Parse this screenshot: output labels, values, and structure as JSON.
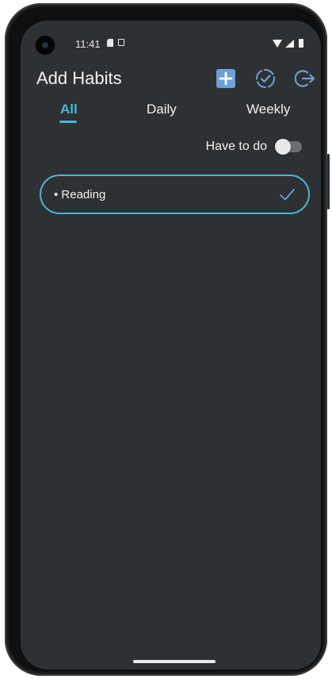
{
  "status_bar": {
    "time": "11:41"
  },
  "app": {
    "title": "Add Habits"
  },
  "header_actions": {
    "add_icon": "add-square-icon",
    "check_icon": "dashed-circle-check-icon",
    "logout_icon": "logout-icon"
  },
  "tabs": [
    {
      "label": "All",
      "selected": true
    },
    {
      "label": "Daily",
      "selected": false
    },
    {
      "label": "Weekly",
      "selected": false
    }
  ],
  "filter": {
    "label": "Have to do",
    "enabled": false
  },
  "habits": [
    {
      "text": "• Reading",
      "icon": "checkmark-icon"
    }
  ],
  "colors": {
    "accent": "#4ab7d6",
    "background": "#2e3134",
    "icon_blue": "#6d9fd9"
  }
}
